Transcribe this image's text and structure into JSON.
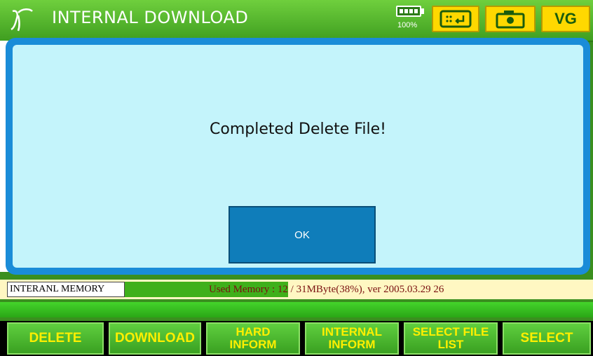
{
  "window": {
    "title": "INTERNAL DOWNLOAD",
    "battery_percent": "100%",
    "vg_label": "VG"
  },
  "dialog": {
    "message": "Completed Delete File!",
    "ok_label": "OK"
  },
  "memory": {
    "label": "INTERANL MEMORY",
    "used_prefix": "Used Memory : 12",
    "used_suffix": " / 31MByte(38%), ver 2005.03.29 26",
    "used_fraction": 0.38
  },
  "softkeys": [
    {
      "line1": "DELETE",
      "line2": ""
    },
    {
      "line1": "DOWNLOAD",
      "line2": ""
    },
    {
      "line1": "HARD",
      "line2": "INFORM"
    },
    {
      "line1": "INTERNAL",
      "line2": "INFORM"
    },
    {
      "line1": "SELECT FILE",
      "line2": "LIST"
    },
    {
      "line1": "SELECT",
      "line2": ""
    }
  ],
  "colors": {
    "dialog_border": "#1a8cd8",
    "dialog_fill": "#c4f4fb",
    "ok_button": "#0f7dba",
    "softkey_text": "#ffef00",
    "memory_fill": "#3fb01b"
  }
}
